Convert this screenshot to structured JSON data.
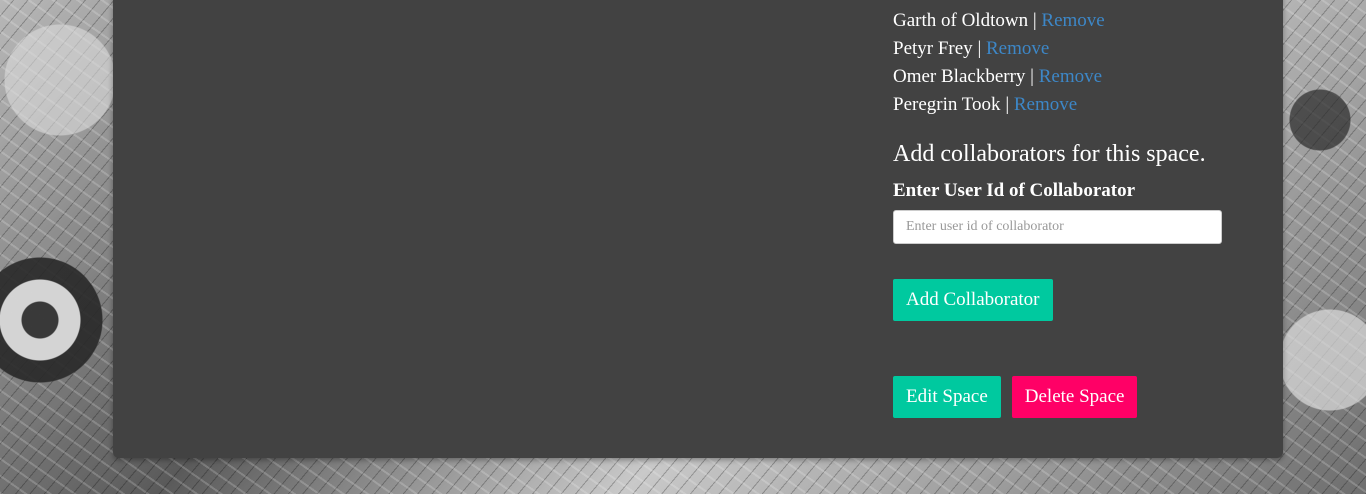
{
  "collaborators": [
    {
      "name": "Garth of Oldtown",
      "separator": "|",
      "action": "Remove"
    },
    {
      "name": "Petyr Frey",
      "separator": "|",
      "action": "Remove"
    },
    {
      "name": "Omer Blackberry",
      "separator": "|",
      "action": "Remove"
    },
    {
      "name": "Peregrin Took",
      "separator": "|",
      "action": "Remove"
    }
  ],
  "add_section": {
    "heading": "Add collaborators for this space.",
    "label": "Enter User Id of Collaborator",
    "input_value": "",
    "placeholder": "Enter user id of collaborator",
    "button": "Add Collaborator"
  },
  "actions": {
    "edit": "Edit Space",
    "delete": "Delete Space"
  },
  "colors": {
    "panel_bg": "#424242",
    "link": "#3d87c7",
    "primary": "#00c99f",
    "danger": "#ff0066"
  }
}
